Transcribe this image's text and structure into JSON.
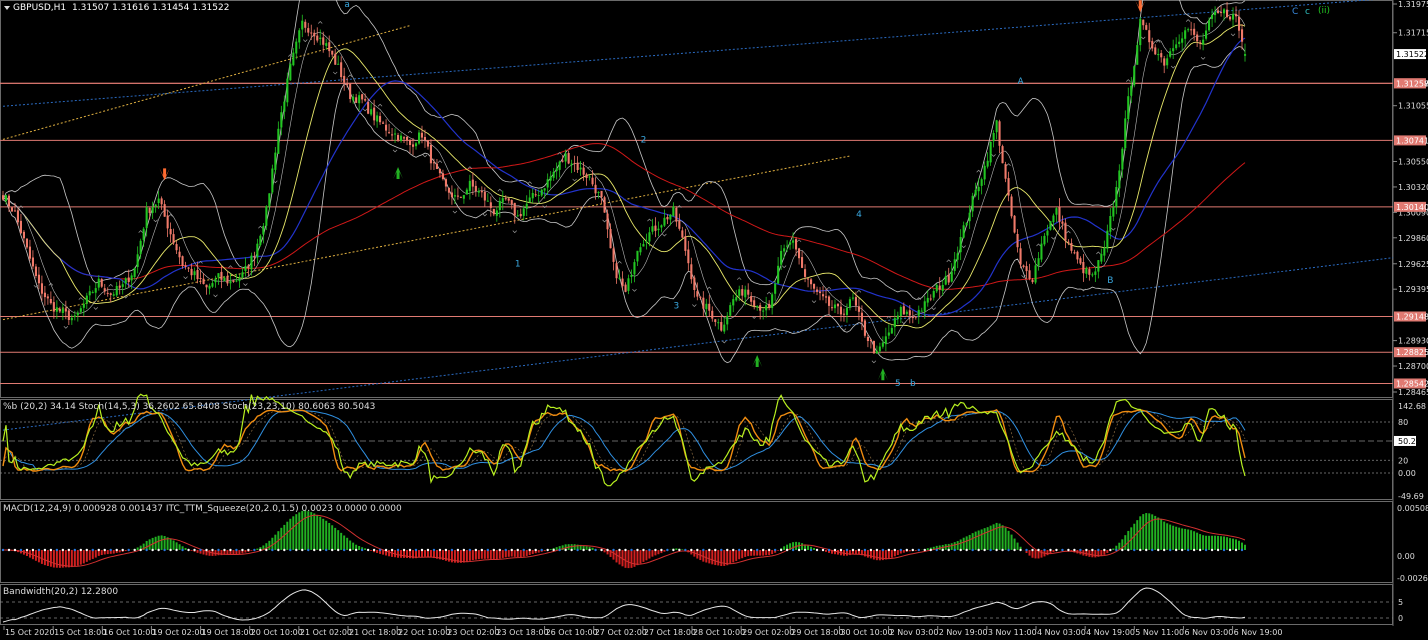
{
  "window": {
    "title": "GBPUSD,H1",
    "ohlc": "1.31507 1.31616 1.31454 1.31522",
    "wave_labels_top_right": [
      "C",
      "c",
      "(ii)"
    ]
  },
  "colors": {
    "background": "#000000",
    "bull": "#22c522",
    "bear": "#f07a6a",
    "hline": "#e07a72",
    "price_tag_bg": "#e07a72",
    "bb": "#c8c8c8",
    "ma_fast": "#e8e86a",
    "ma_mid": "#2233cc",
    "ma_slow": "#d01818",
    "channel_upper": "#2a6ac0",
    "channel_dotted": "#e0b040",
    "percent_b": "#b8f020",
    "stoch_fast": "#f08c10",
    "stoch_slow": "#2f8fe0",
    "macd_pos": "#22b022",
    "macd_neg": "#d02020",
    "macd_signal": "#d03030",
    "bandwidth": "#e8e8e8",
    "arrow_down": "#ff6a30",
    "arrow_up": "#22b022"
  },
  "price_axis": {
    "labels": [
      "1.31975",
      "1.31715",
      "1.31055",
      "1.30550",
      "1.30320",
      "1.30090",
      "1.29860",
      "1.29625",
      "1.29395",
      "1.28930",
      "1.28700",
      "1.28465"
    ],
    "tags": [
      "1.31257",
      "1.31522",
      "1.31258",
      "1.30741",
      "1.30140",
      "1.29148",
      "1.28825",
      "1.28542"
    ]
  },
  "time_axis": {
    "labels": [
      "15 Oct 2020",
      "15 Oct 18:00",
      "16 Oct 10:00",
      "19 Oct 02:00",
      "19 Oct 18:00",
      "20 Oct 10:00",
      "21 Oct 02:00",
      "21 Oct 18:00",
      "22 Oct 10:00",
      "23 Oct 02:00",
      "23 Oct 18:00",
      "26 Oct 10:00",
      "27 Oct 02:00",
      "27 Oct 18:00",
      "28 Oct 10:00",
      "29 Oct 02:00",
      "29 Oct 18:00",
      "30 Oct 10:00",
      "2 Nov 03:00",
      "2 Nov 19:00",
      "3 Nov 11:00",
      "4 Nov 03:00",
      "4 Nov 19:00",
      "5 Nov 11:00",
      "6 Nov 03:00",
      "6 Nov 19:00"
    ]
  },
  "wave_labels": [
    "a",
    "1",
    "2",
    "3",
    "4",
    "5",
    "b",
    "A",
    "B"
  ],
  "sub_windows": {
    "stoch": {
      "label": "%b (20,2) 34.14  Stoch(14,5,3) 36.2602 65.8408  Stoch(23,23,10) 80.6063 80.5043",
      "axis": [
        "142.68",
        "80",
        "50.24",
        "0.00",
        "20",
        "-49.69"
      ]
    },
    "macd": {
      "label": "MACD(12,24,9) 0.000928 0.001437  ITC_TTM_Squeeze(20,2.0,1.5) 0.0023 0.0000 0.0000",
      "axis": [
        "0.005086",
        "0.00",
        "-0.002602"
      ]
    },
    "bandwidth": {
      "label": "Bandwidth(20,2) 12.2800",
      "axis": [
        "0",
        "5"
      ]
    }
  },
  "chart_data": {
    "type": "candlestick",
    "symbol": "GBPUSD",
    "timeframe": "H1",
    "last_bar": {
      "open": 1.31507,
      "high": 1.31616,
      "low": 1.31454,
      "close": 1.31522
    },
    "ylim": [
      1.28465,
      1.31975
    ],
    "horizontal_levels": [
      1.31257,
      1.31258,
      1.30741,
      1.3014,
      1.29148,
      1.28825,
      1.28542
    ],
    "close_path": [
      [
        0,
        1.3025
      ],
      [
        4,
        1.3008
      ],
      [
        8,
        1.2975
      ],
      [
        12,
        1.2942
      ],
      [
        16,
        1.2925
      ],
      [
        20,
        1.2918
      ],
      [
        24,
        1.2912
      ],
      [
        28,
        1.293
      ],
      [
        32,
        1.2946
      ],
      [
        36,
        1.2935
      ],
      [
        40,
        1.2942
      ],
      [
        44,
        1.2958
      ],
      [
        48,
        1.301
      ],
      [
        52,
        1.302
      ],
      [
        56,
        1.299
      ],
      [
        60,
        1.2962
      ],
      [
        64,
        1.2952
      ],
      [
        68,
        1.294
      ],
      [
        72,
        1.295
      ],
      [
        76,
        1.2946
      ],
      [
        80,
        1.2952
      ],
      [
        84,
        1.2972
      ],
      [
        88,
        1.301
      ],
      [
        92,
        1.3085
      ],
      [
        96,
        1.314
      ],
      [
        100,
        1.318
      ],
      [
        104,
        1.3172
      ],
      [
        108,
        1.316
      ],
      [
        112,
        1.314
      ],
      [
        116,
        1.3115
      ],
      [
        120,
        1.311
      ],
      [
        124,
        1.3095
      ],
      [
        128,
        1.3085
      ],
      [
        132,
        1.3078
      ],
      [
        136,
        1.307
      ],
      [
        140,
        1.308
      ],
      [
        144,
        1.305
      ],
      [
        148,
        1.303
      ],
      [
        152,
        1.302
      ],
      [
        156,
        1.3034
      ],
      [
        160,
        1.3025
      ],
      [
        164,
        1.301
      ],
      [
        168,
        1.302
      ],
      [
        172,
        1.3005
      ],
      [
        176,
        1.302
      ],
      [
        180,
        1.303
      ],
      [
        184,
        1.3045
      ],
      [
        188,
        1.306
      ],
      [
        192,
        1.305
      ],
      [
        196,
        1.304
      ],
      [
        200,
        1.302
      ],
      [
        204,
        1.296
      ],
      [
        208,
        1.2935
      ],
      [
        212,
        1.2978
      ],
      [
        216,
        1.299
      ],
      [
        220,
        1.3
      ],
      [
        224,
        1.301
      ],
      [
        228,
        1.2975
      ],
      [
        232,
        1.293
      ],
      [
        236,
        1.292
      ],
      [
        240,
        1.2905
      ],
      [
        244,
        1.293
      ],
      [
        248,
        1.294
      ],
      [
        252,
        1.2925
      ],
      [
        256,
        1.292
      ],
      [
        260,
        1.297
      ],
      [
        264,
        1.2985
      ],
      [
        268,
        1.295
      ],
      [
        272,
        1.2935
      ],
      [
        276,
        1.2925
      ],
      [
        280,
        1.2918
      ],
      [
        284,
        1.293
      ],
      [
        288,
        1.29
      ],
      [
        292,
        1.288
      ],
      [
        296,
        1.29
      ],
      [
        300,
        1.292
      ],
      [
        304,
        1.2915
      ],
      [
        308,
        1.2925
      ],
      [
        312,
        1.294
      ],
      [
        316,
        1.295
      ],
      [
        320,
        1.2985
      ],
      [
        324,
        1.302
      ],
      [
        328,
        1.305
      ],
      [
        332,
        1.309
      ],
      [
        336,
        1.302
      ],
      [
        340,
        1.296
      ],
      [
        344,
        1.295
      ],
      [
        348,
        1.299
      ],
      [
        352,
        1.301
      ],
      [
        356,
        1.298
      ],
      [
        360,
        1.296
      ],
      [
        364,
        1.295
      ],
      [
        368,
        1.2975
      ],
      [
        372,
        1.303
      ],
      [
        376,
        1.311
      ],
      [
        380,
        1.318
      ],
      [
        384,
        1.316
      ],
      [
        388,
        1.3145
      ],
      [
        392,
        1.3165
      ],
      [
        396,
        1.3175
      ],
      [
        400,
        1.316
      ],
      [
        404,
        1.3185
      ],
      [
        408,
        1.319
      ],
      [
        412,
        1.3185
      ],
      [
        415,
        1.3152
      ]
    ],
    "annotations": [
      {
        "text": "a",
        "x": 115,
        "y": 1.3195
      },
      {
        "text": "1",
        "x": 172,
        "y": 1.296
      },
      {
        "text": "2",
        "x": 214,
        "y": 1.3072
      },
      {
        "text": "3",
        "x": 225,
        "y": 1.2922
      },
      {
        "text": "4",
        "x": 286,
        "y": 1.3005
      },
      {
        "text": "5",
        "x": 299,
        "y": 1.2852
      },
      {
        "text": "b",
        "x": 304,
        "y": 1.2852
      },
      {
        "text": "A",
        "x": 340,
        "y": 1.3125
      },
      {
        "text": "B",
        "x": 370,
        "y": 1.2945
      }
    ]
  }
}
